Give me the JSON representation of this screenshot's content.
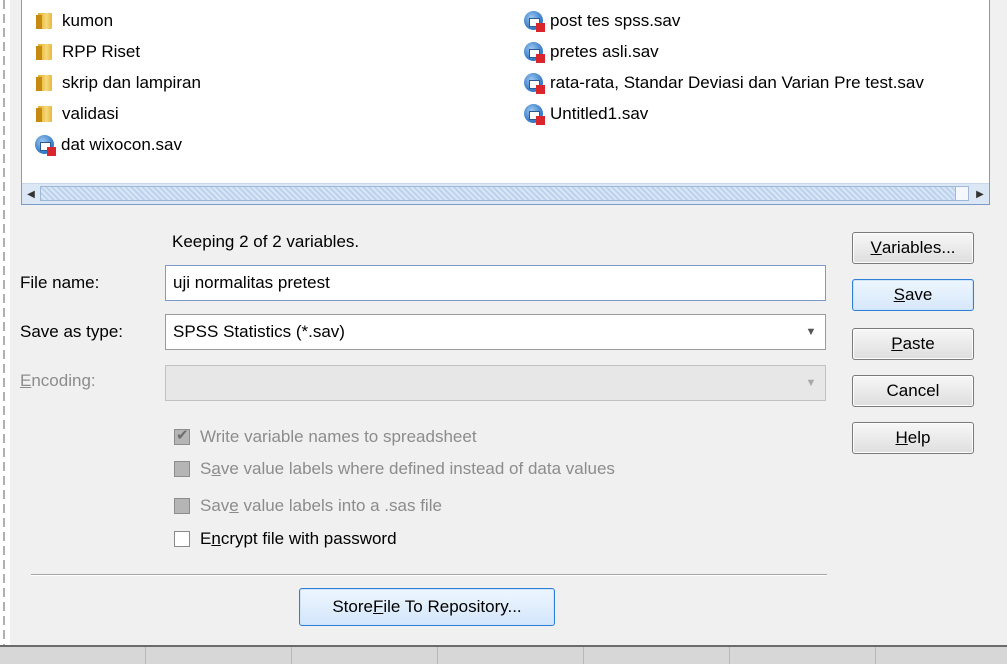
{
  "files_left": [
    {
      "name": "kumon",
      "type": "folder"
    },
    {
      "name": "RPP Riset",
      "type": "folder"
    },
    {
      "name": "skrip dan lampiran",
      "type": "folder"
    },
    {
      "name": "validasi",
      "type": "folder"
    },
    {
      "name": "dat wixocon.sav",
      "type": "sav"
    }
  ],
  "files_right": [
    {
      "name": "post tes spss.sav",
      "type": "sav"
    },
    {
      "name": "pretes asli.sav",
      "type": "sav"
    },
    {
      "name": "rata-rata, Standar Deviasi dan Varian Pre test.sav",
      "type": "sav"
    },
    {
      "name": "Untitled1.sav",
      "type": "sav"
    }
  ],
  "keeping_text": "Keeping 2 of 2 variables.",
  "filename": {
    "label": "File name:",
    "value": "uji normalitas pretest"
  },
  "saveas": {
    "label": "Save as type:",
    "value": "SPSS Statistics (*.sav)"
  },
  "encoding": {
    "label_u": "E",
    "label_rest": "ncoding:",
    "value": ""
  },
  "options": {
    "write_names": {
      "label": "Write variable names to spreadsheet",
      "checked": true,
      "enabled": false
    },
    "save_labels_pre": "S",
    "save_labels_u": "a",
    "save_labels_rest": "ve value labels where defined instead of data values",
    "sas_pre": "Sav",
    "sas_u": "e",
    "sas_rest": " value labels into a .sas file",
    "encrypt_pre": "E",
    "encrypt_u": "n",
    "encrypt_rest": "crypt file with password"
  },
  "buttons": {
    "variables_u": "V",
    "variables_rest": "ariables...",
    "save_u": "S",
    "save_rest": "ave",
    "paste_u": "P",
    "paste_rest": "aste",
    "cancel": "Cancel",
    "help_u": "H",
    "help_rest": "elp",
    "repo_pre": "Store ",
    "repo_u": "F",
    "repo_rest": "ile To Repository..."
  }
}
